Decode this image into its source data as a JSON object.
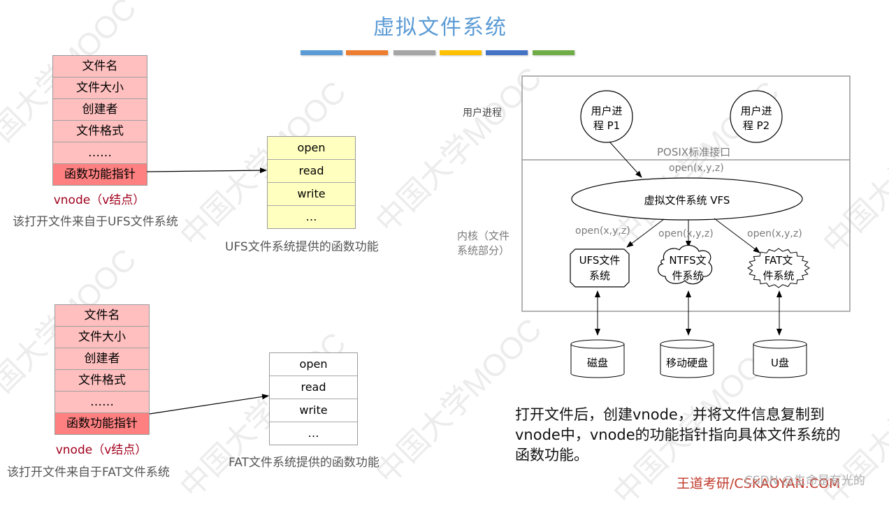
{
  "title": "虚拟文件系统",
  "title_stripes": [
    "#5b9bd5",
    "#ed7d31",
    "#a5a5a5",
    "#ffc000",
    "#4472c4",
    "#70ad47"
  ],
  "watermark": "中国大学MOOC",
  "top_example": {
    "vnode_fields": [
      "文件名",
      "文件大小",
      "创建者",
      "文件格式",
      "……",
      "函数功能指针"
    ],
    "vnode_label": "vnode（v结点）",
    "source_label": "该打开文件来自于UFS文件系统",
    "functions": [
      "open",
      "read",
      "write",
      "…"
    ],
    "functions_label": "UFS文件系统提供的函数功能"
  },
  "bottom_example": {
    "vnode_fields": [
      "文件名",
      "文件大小",
      "创建者",
      "文件格式",
      "……",
      "函数功能指针"
    ],
    "vnode_label": "vnode（v结点）",
    "source_label": "该打开文件来自于FAT文件系统",
    "functions": [
      "open",
      "read",
      "write",
      "…"
    ],
    "functions_label": "FAT文件系统提供的函数功能"
  },
  "architecture": {
    "user_layer_label": "用户进程",
    "kernel_layer_label_line1": "内核（文件",
    "kernel_layer_label_line2": "系统部分）",
    "process1_line1": "用户进",
    "process1_line2": "程 P1",
    "process2_line1": "用户进",
    "process2_line2": "程 P2",
    "posix_label": "POSIX标准接口",
    "vfs_call": "open(x,y,z)",
    "vfs_label": "虚拟文件系统 VFS",
    "fs_calls": [
      "open(x,y,z)",
      "open(x,y,z)",
      "open(x,y,z)"
    ],
    "filesystems": [
      {
        "line1": "UFS文件",
        "line2": "系统"
      },
      {
        "line1": "NTFS文",
        "line2": "件系统"
      },
      {
        "line1": "FAT文",
        "line2": "件系统"
      }
    ],
    "devices": [
      "磁盘",
      "移动硬盘",
      "U盘"
    ]
  },
  "description": "打开文件后，创建vnode，并将文件信息复制到vnode中，vnode的功能指针指向具体文件系统的函数功能。",
  "footer": "王道考研/CSKAOYAN.COM",
  "csdn_mark": "CSDN @生命是有光的"
}
